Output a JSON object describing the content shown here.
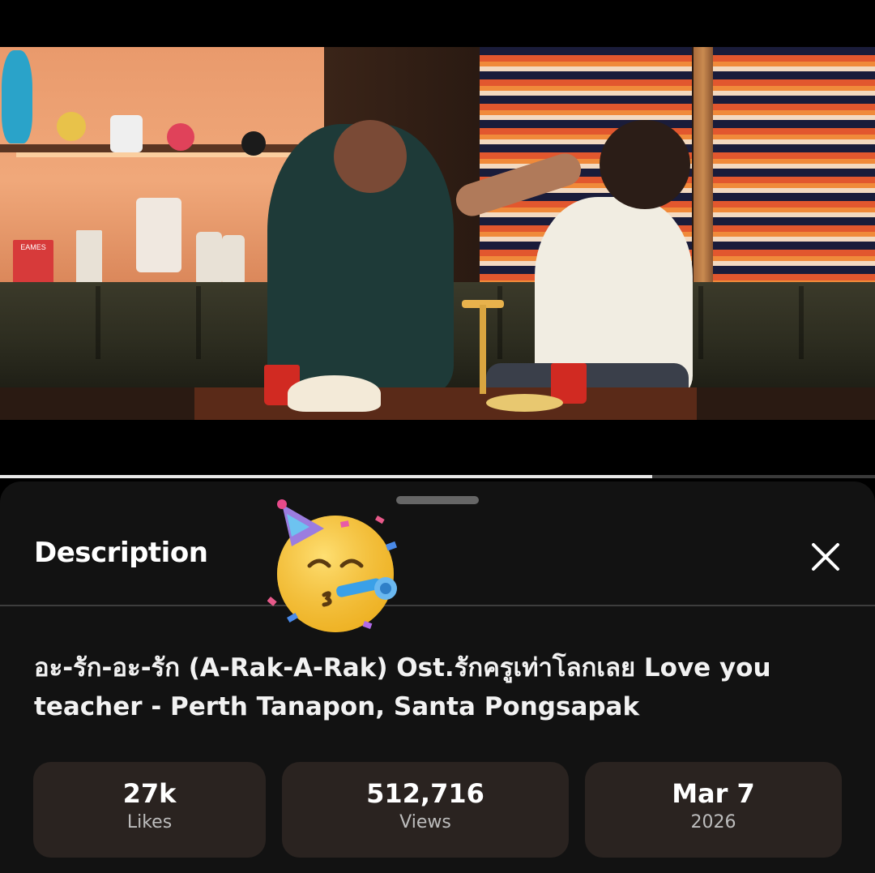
{
  "sheet": {
    "title": "Description",
    "video_title": "อะ-รัก-อะ-รัก (A-Rak-A-Rak) Ost.รักครูเท่าโลกเลย Love you teacher - Perth Tanapon, Santa Pongsapak"
  },
  "stats": {
    "likes": {
      "value": "27k",
      "label": "Likes"
    },
    "views": {
      "value": "512,716",
      "label": "Views"
    },
    "date": {
      "value": "Mar 7",
      "label": "2026"
    }
  },
  "player": {
    "progress_fraction": 0.745
  },
  "shelf_item": {
    "book_label": "EAMES"
  },
  "icons": {
    "close": "close-icon",
    "emoji": "partying-face-icon"
  }
}
